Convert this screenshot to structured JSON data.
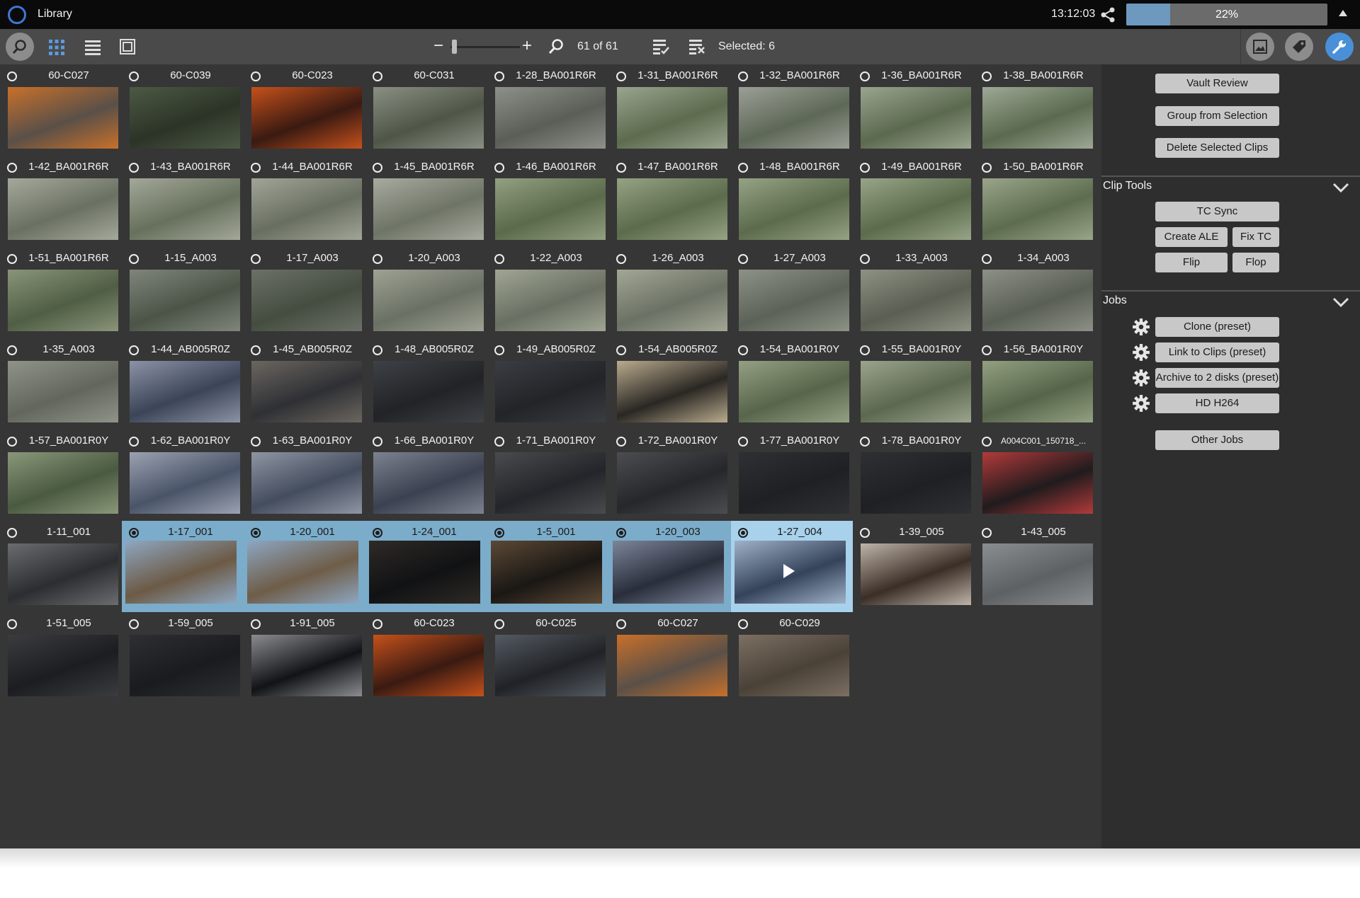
{
  "window": {
    "title": "Library",
    "clock": "13:12:03",
    "progress_label": "22%",
    "progress_fraction": 0.22
  },
  "toolbar": {
    "count": "61 of 61",
    "selected": "Selected: 6",
    "zoom_minus": "−",
    "zoom_plus": "+"
  },
  "clips": [
    {
      "name": "60-C027",
      "c1": "#5a5048",
      "c2": "#c8702a"
    },
    {
      "name": "60-C039",
      "c1": "#2c3327",
      "c2": "#4c5a44"
    },
    {
      "name": "60-C023",
      "c1": "#3a1a12",
      "c2": "#c5511b"
    },
    {
      "name": "60-C031",
      "c1": "#4f5647",
      "c2": "#8a8f83"
    },
    {
      "name": "1-28_BA001R6R",
      "c1": "#5a5e57",
      "c2": "#8e918a"
    },
    {
      "name": "1-31_BA001R6R",
      "c1": "#5d6b4e",
      "c2": "#9aa48f"
    },
    {
      "name": "1-32_BA001R6R",
      "c1": "#5e6857",
      "c2": "#9b9f96"
    },
    {
      "name": "1-36_BA001R6R",
      "c1": "#5b6a4f",
      "c2": "#9aa48f"
    },
    {
      "name": "1-38_BA001R6R",
      "c1": "#5b6a4f",
      "c2": "#9ea896"
    },
    {
      "name": "1-42_BA001R6R",
      "c1": "#6a7062",
      "c2": "#a4a99c"
    },
    {
      "name": "1-43_BA001R6R",
      "c1": "#67705d",
      "c2": "#a3a898"
    },
    {
      "name": "1-44_BA001R6R",
      "c1": "#686e60",
      "c2": "#a0a598"
    },
    {
      "name": "1-45_BA001R6R",
      "c1": "#6e7466",
      "c2": "#a7aba0"
    },
    {
      "name": "1-46_BA001R6R",
      "c1": "#5a6a4b",
      "c2": "#93a081"
    },
    {
      "name": "1-47_BA001R6R",
      "c1": "#5b6b4c",
      "c2": "#96a284"
    },
    {
      "name": "1-48_BA001R6R",
      "c1": "#5b6b4c",
      "c2": "#96a284"
    },
    {
      "name": "1-49_BA001R6R",
      "c1": "#5b6b4c",
      "c2": "#98a487"
    },
    {
      "name": "1-50_BA001R6R",
      "c1": "#5d6c4f",
      "c2": "#9aa58a"
    },
    {
      "name": "1-51_BA001R6R",
      "c1": "#4f5e44",
      "c2": "#8a9479"
    },
    {
      "name": "1-15_A003",
      "c1": "#4c5448",
      "c2": "#7f857a"
    },
    {
      "name": "1-17_A003",
      "c1": "#454c40",
      "c2": "#6b7166"
    },
    {
      "name": "1-20_A003",
      "c1": "#6a7064",
      "c2": "#9da293"
    },
    {
      "name": "1-22_A003",
      "c1": "#697063",
      "c2": "#a0a593"
    },
    {
      "name": "1-26_A003",
      "c1": "#6b7164",
      "c2": "#a2a795"
    },
    {
      "name": "1-27_A003",
      "c1": "#5c6257",
      "c2": "#8d9287"
    },
    {
      "name": "1-33_A003",
      "c1": "#5a5e53",
      "c2": "#8e9283"
    },
    {
      "name": "1-34_A003",
      "c1": "#5a5f55",
      "c2": "#8c9086"
    },
    {
      "name": "1-35_A003",
      "c1": "#62665c",
      "c2": "#8f9388"
    },
    {
      "name": "1-44_AB005R0Z",
      "c1": "#3c4457",
      "c2": "#8c93a6"
    },
    {
      "name": "1-45_AB005R0Z",
      "c1": "#2f3034",
      "c2": "#6b6660"
    },
    {
      "name": "1-48_AB005R0Z",
      "c1": "#212326",
      "c2": "#3e4146"
    },
    {
      "name": "1-49_AB005R0Z",
      "c1": "#222428",
      "c2": "#3a3d42"
    },
    {
      "name": "1-54_AB005R0Z",
      "c1": "#2a2723",
      "c2": "#b9ab8e"
    },
    {
      "name": "1-54_BA001R0Y",
      "c1": "#57654a",
      "c2": "#95a083"
    },
    {
      "name": "1-55_BA001R0Y",
      "c1": "#5c684f",
      "c2": "#9ba38c"
    },
    {
      "name": "1-56_BA001R0Y",
      "c1": "#56654a",
      "c2": "#93a081"
    },
    {
      "name": "1-57_BA001R0Y",
      "c1": "#4a5a40",
      "c2": "#8a977a"
    },
    {
      "name": "1-62_BA001R0Y",
      "c1": "#4a5468",
      "c2": "#9ba2b1"
    },
    {
      "name": "1-63_BA001R0Y",
      "c1": "#444d5e",
      "c2": "#8f95a3"
    },
    {
      "name": "1-66_BA001R0Y",
      "c1": "#3b4150",
      "c2": "#7d8290"
    },
    {
      "name": "1-71_BA001R0Y",
      "c1": "#24252a",
      "c2": "#4a4b4e"
    },
    {
      "name": "1-72_BA001R0Y",
      "c1": "#26272b",
      "c2": "#4c4d50"
    },
    {
      "name": "1-77_BA001R0Y",
      "c1": "#1f2023",
      "c2": "#2e3033"
    },
    {
      "name": "1-78_BA001R0Y",
      "c1": "#1f2023",
      "c2": "#2e3033"
    },
    {
      "name": "A004C001_150718_...",
      "c1": "#201b1d",
      "c2": "#b23a3a",
      "small": true
    },
    {
      "name": "1-11_001",
      "c1": "#2c2d30",
      "c2": "#6b6c70"
    },
    {
      "name": "1-17_001",
      "c1": "#6c5a45",
      "c2": "#8fa7c2",
      "selected": true
    },
    {
      "name": "1-20_001",
      "c1": "#6e5d48",
      "c2": "#8ea6c1",
      "selected": true
    },
    {
      "name": "1-24_001",
      "c1": "#111214",
      "c2": "#2e2a26",
      "selected": true
    },
    {
      "name": "1-5_001",
      "c1": "#1a1714",
      "c2": "#5c4936",
      "selected": true
    },
    {
      "name": "1-20_003",
      "c1": "#2a2e3b",
      "c2": "#7c8599",
      "selected": true
    },
    {
      "name": "1-27_004",
      "c1": "#35435a",
      "c2": "#9fb2c8",
      "selected": true,
      "active": true,
      "play": true
    },
    {
      "name": "1-39_005",
      "c1": "#3a2e27",
      "c2": "#bfb4a8"
    },
    {
      "name": "1-43_005",
      "c1": "#5e6163",
      "c2": "#8b8e90"
    },
    {
      "name": "1-51_005",
      "c1": "#1c1d20",
      "c2": "#3b3c40"
    },
    {
      "name": "1-59_005",
      "c1": "#1a1b1e",
      "c2": "#2e2f33"
    },
    {
      "name": "1-91_005",
      "c1": "#121316",
      "c2": "#8a8c90"
    },
    {
      "name": "60-C023",
      "c1": "#3a1a12",
      "c2": "#c5511b"
    },
    {
      "name": "60-C025",
      "c1": "#202226",
      "c2": "#545b62"
    },
    {
      "name": "60-C027",
      "c1": "#5a5048",
      "c2": "#c8702a"
    },
    {
      "name": "60-C029",
      "c1": "#4a4138",
      "c2": "#7c7062"
    }
  ],
  "panel": {
    "buttons_top": [
      "Vault Review",
      "Group from Selection",
      "Delete Selected Clips"
    ],
    "clip_tools": {
      "header": "Clip Tools",
      "tc_sync": "TC Sync",
      "create_ale": "Create ALE",
      "fix_tc": "Fix TC",
      "flip": "Flip",
      "flop": "Flop"
    },
    "jobs": {
      "header": "Jobs",
      "items": [
        "Clone (preset)",
        "Link to Clips (preset)",
        "Archive to 2 disks (preset)",
        "HD H264"
      ],
      "other": "Other Jobs"
    }
  }
}
